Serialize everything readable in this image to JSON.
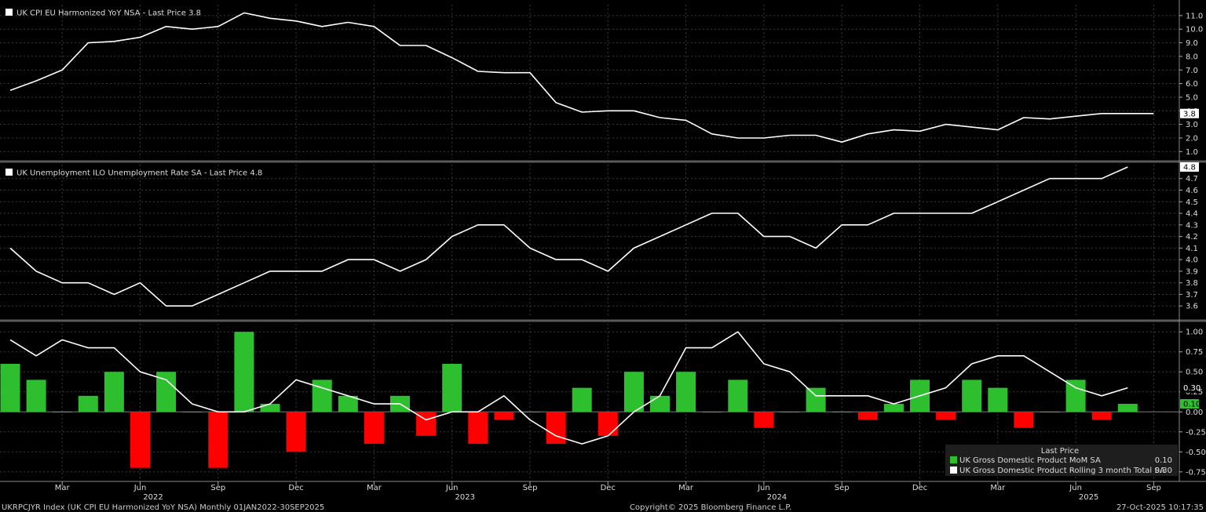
{
  "chart_data": [
    {
      "type": "line",
      "title": "UK CPI EU Harmonized YoY NSA - Last Price 3.8",
      "last_price": "3.8",
      "ylim": [
        0.5,
        11.8
      ],
      "y_ticks": [
        "1.0",
        "2.0",
        "3.0",
        "4.0",
        "5.0",
        "6.0",
        "7.0",
        "8.0",
        "9.0",
        "10.0",
        "11.0"
      ],
      "grid": true,
      "series": [
        {
          "values": [
            5.5,
            6.2,
            7.0,
            9.0,
            9.1,
            9.4,
            10.2,
            10.0,
            10.2,
            11.2,
            10.8,
            10.6,
            10.2,
            10.5,
            10.2,
            8.8,
            8.8,
            7.9,
            6.9,
            6.8,
            6.8,
            4.6,
            3.9,
            4.0,
            4.0,
            3.5,
            3.3,
            2.3,
            2.0,
            2.0,
            2.2,
            2.2,
            1.7,
            2.3,
            2.6,
            2.5,
            3.0,
            2.8,
            2.6,
            3.5,
            3.4,
            3.6,
            3.8,
            3.8,
            3.8
          ]
        }
      ]
    },
    {
      "type": "line",
      "title": "UK Unemployment ILO Unemployment Rate SA - Last Price 4.8",
      "last_price": "4.8",
      "ylim": [
        3.5,
        4.82
      ],
      "y_ticks": [
        "3.6",
        "3.7",
        "3.8",
        "3.9",
        "4.0",
        "4.1",
        "4.2",
        "4.3",
        "4.4",
        "4.5",
        "4.6",
        "4.7"
      ],
      "grid": true,
      "series": [
        {
          "values": [
            4.1,
            3.9,
            3.8,
            3.8,
            3.7,
            3.8,
            3.6,
            3.6,
            3.7,
            3.8,
            3.9,
            3.9,
            3.9,
            4.0,
            4.0,
            3.9,
            4.0,
            4.2,
            4.3,
            4.3,
            4.1,
            4.0,
            4.0,
            3.9,
            4.1,
            4.2,
            4.3,
            4.4,
            4.4,
            4.2,
            4.2,
            4.1,
            4.3,
            4.3,
            4.4,
            4.4,
            4.4,
            4.4,
            4.5,
            4.6,
            4.7,
            4.7,
            4.7,
            4.8
          ]
        }
      ]
    },
    {
      "type": "bar",
      "ylim": [
        -0.85,
        1.1
      ],
      "y_ticks": [
        "1.00",
        "0.75",
        "0.50",
        "0.25",
        "0.00",
        "-0.25",
        "-0.50",
        "-0.75"
      ],
      "last_labels": [
        "0.30",
        "0.10"
      ],
      "grid": true,
      "legend_header": "Last Price",
      "legend": [
        {
          "name": "UK Gross Domestic Product MoM SA",
          "value": "0.10",
          "color": "#2ebf2e"
        },
        {
          "name": "UK Gross Domestic Product Rolling 3 month Total SA",
          "value": "0.30",
          "color": "#ffffff"
        }
      ],
      "series": [
        {
          "name": "UK Gross Domestic Product MoM SA",
          "kind": "bar",
          "values": [
            0.6,
            0.4,
            0.0,
            0.2,
            0.5,
            -0.7,
            0.5,
            0.0,
            -0.7,
            1.0,
            0.1,
            -0.5,
            0.4,
            0.2,
            -0.4,
            0.2,
            -0.3,
            0.6,
            -0.4,
            -0.1,
            0.0,
            -0.4,
            0.3,
            -0.3,
            0.5,
            0.2,
            0.5,
            0.0,
            0.4,
            -0.2,
            0.0,
            0.3,
            0.0,
            -0.1,
            0.1,
            0.4,
            -0.1,
            0.4,
            0.3,
            -0.2,
            0.0,
            0.4,
            -0.1,
            0.1
          ]
        },
        {
          "name": "UK Gross Domestic Product Rolling 3 month Total SA",
          "kind": "line",
          "values": [
            0.9,
            0.7,
            0.9,
            0.8,
            0.8,
            0.5,
            0.4,
            0.1,
            0.0,
            0.0,
            0.1,
            0.4,
            0.3,
            0.2,
            0.1,
            0.1,
            -0.1,
            0.0,
            0.0,
            0.2,
            -0.1,
            -0.3,
            -0.4,
            -0.3,
            0.0,
            0.2,
            0.8,
            0.8,
            1.0,
            0.6,
            0.5,
            0.2,
            0.2,
            0.2,
            0.1,
            0.2,
            0.3,
            0.6,
            0.7,
            0.7,
            0.5,
            0.3,
            0.2,
            0.3
          ]
        }
      ]
    }
  ],
  "x_axis": {
    "start_index": 0,
    "month_ticks": [
      {
        "label": "Mar",
        "index": 2
      },
      {
        "label": "Jun",
        "index": 5
      },
      {
        "label": "Sep",
        "index": 8
      },
      {
        "label": "Dec",
        "index": 11
      },
      {
        "label": "Mar",
        "index": 14
      },
      {
        "label": "Jun",
        "index": 17
      },
      {
        "label": "Sep",
        "index": 20
      },
      {
        "label": "Dec",
        "index": 23
      },
      {
        "label": "Mar",
        "index": 26
      },
      {
        "label": "Jun",
        "index": 29
      },
      {
        "label": "Sep",
        "index": 32
      },
      {
        "label": "Dec",
        "index": 35
      },
      {
        "label": "Mar",
        "index": 38
      },
      {
        "label": "Jun",
        "index": 41
      },
      {
        "label": "Sep",
        "index": 44
      }
    ],
    "year_labels": [
      {
        "label": "2022",
        "index": 5.5
      },
      {
        "label": "2023",
        "index": 17.5
      },
      {
        "label": "2024",
        "index": 29.5
      },
      {
        "label": "2025",
        "index": 41.5
      }
    ]
  },
  "footer": {
    "left": "UKRPCJYR Index (UK CPI EU Harmonized YoY NSA) Monthly 01JAN2022-30SEP2025",
    "center": "Copyright© 2025 Bloomberg Finance L.P.",
    "right": "27-Oct-2025 10:17:35"
  },
  "colors": {
    "background": "#000000",
    "grid": "#3a3a3a",
    "line": "#ffffff",
    "bar_up": "#2ebf2e",
    "bar_down": "#ff0000",
    "separator": "#5a5a5a"
  }
}
